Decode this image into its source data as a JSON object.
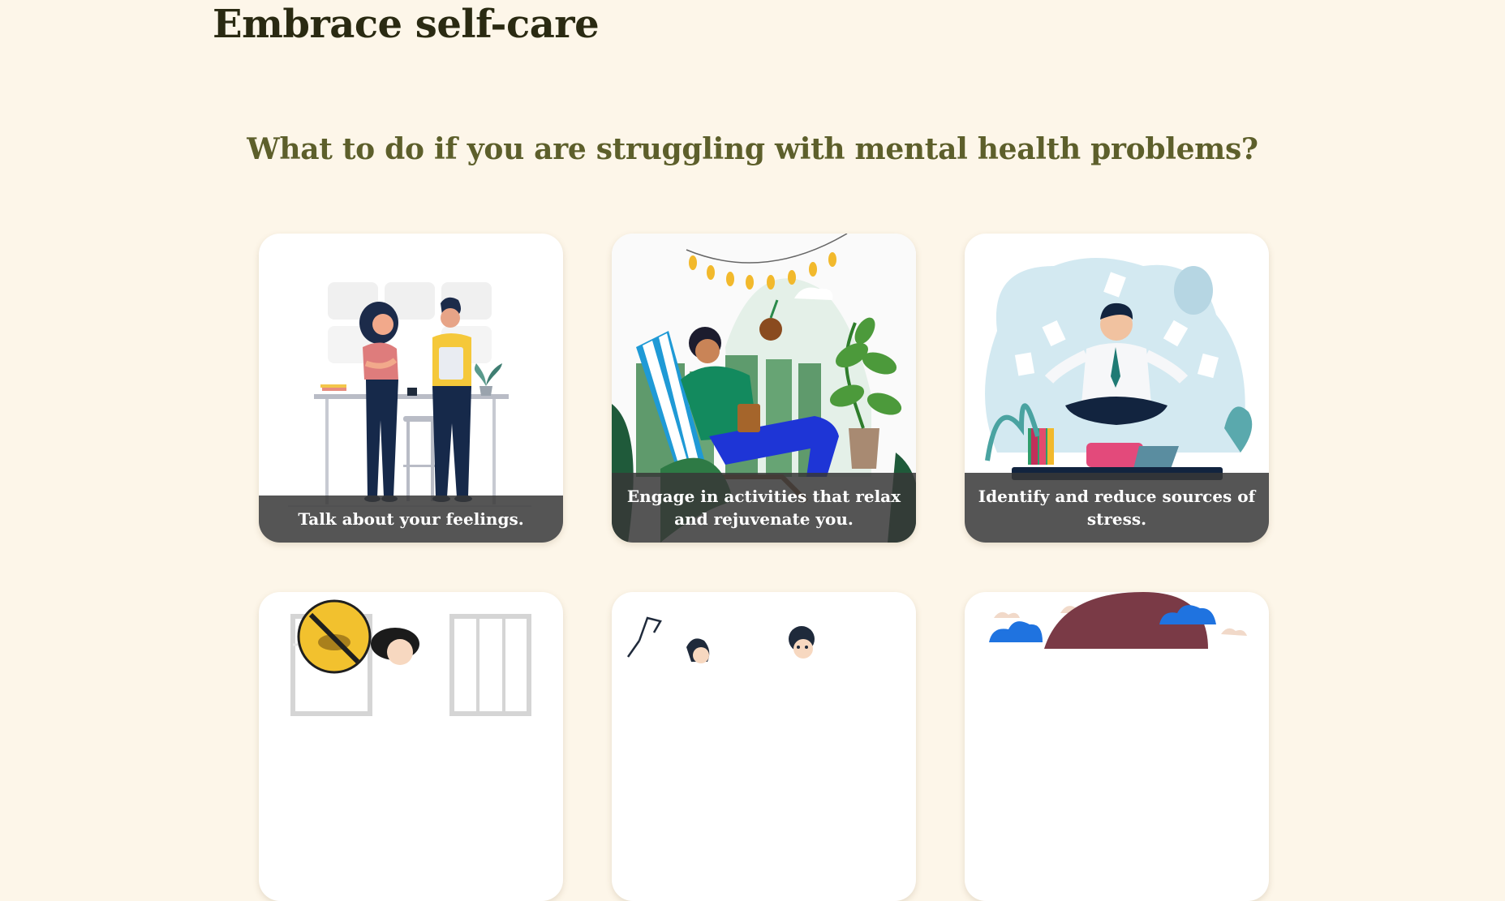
{
  "page": {
    "title": "Embrace self-care",
    "section_heading": "What to do if you are struggling with mental health problems?"
  },
  "cards": [
    {
      "caption": "Talk about your feelings.",
      "illustration": "two-people-talking-illustration"
    },
    {
      "caption": "Engage in activities that relax and rejuvenate you.",
      "illustration": "man-relaxing-in-deck-chair-illustration"
    },
    {
      "caption": "Identify and reduce sources of stress.",
      "illustration": "man-meditating-illustration"
    },
    {
      "caption": "",
      "illustration": "no-alcohol-illustration"
    },
    {
      "caption": "",
      "illustration": "people-waving-illustration"
    },
    {
      "caption": "",
      "illustration": "umbrella-clouds-illustration"
    }
  ],
  "colors": {
    "background": "#fdf6e9",
    "title": "#2a2a12",
    "heading": "#5d5f2b",
    "caption_bg": "#373737"
  }
}
